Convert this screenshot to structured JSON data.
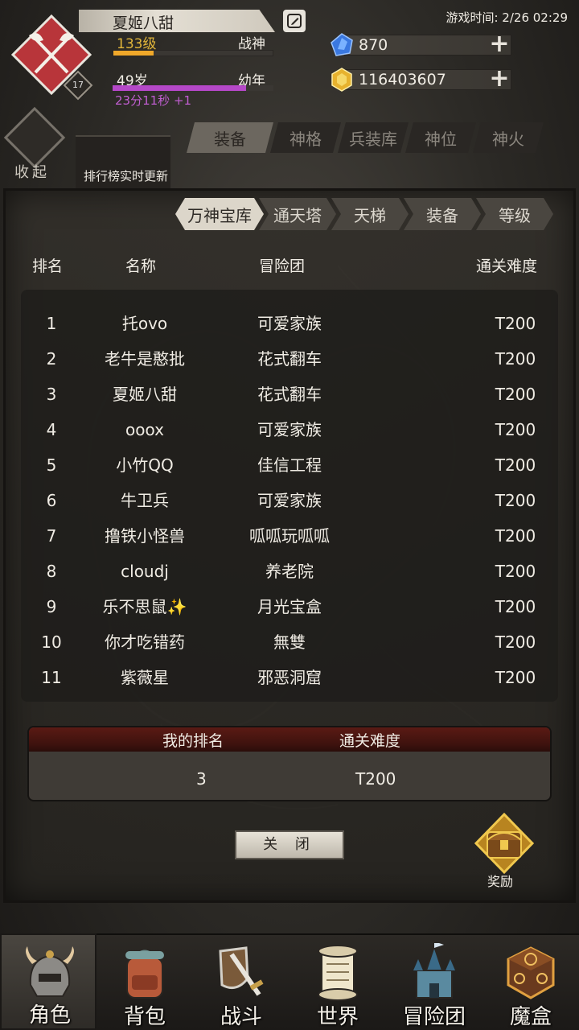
{
  "player": {
    "name": "夏姬八甜",
    "level": "133级",
    "title": "战神",
    "level_progress": 0.25,
    "badge": "17",
    "age": "49岁",
    "stage": "幼年",
    "age_progress": 0.83,
    "timer": "23分11秒 +1"
  },
  "game_time": "游戏时间: 2/26 02:29",
  "currency": {
    "gems": "870",
    "gold": "116403607"
  },
  "collapse_label": "收起",
  "notice": "排行榜实时更新",
  "top_tabs": [
    "装备",
    "神格",
    "兵装库",
    "神位",
    "神火"
  ],
  "sub_tabs": [
    "万神宝库",
    "通天塔",
    "天梯",
    "装备",
    "等级"
  ],
  "columns": {
    "rank": "排名",
    "name": "名称",
    "team": "冒险团",
    "difficulty": "通关难度"
  },
  "rows": [
    {
      "rank": "1",
      "name": "托ovo",
      "team": "可爱家族",
      "difficulty": "T200"
    },
    {
      "rank": "2",
      "name": "老牛是憨批",
      "team": "花式翻车",
      "difficulty": "T200"
    },
    {
      "rank": "3",
      "name": "夏姬八甜",
      "team": "花式翻车",
      "difficulty": "T200"
    },
    {
      "rank": "4",
      "name": "ooox",
      "team": "可爱家族",
      "difficulty": "T200"
    },
    {
      "rank": "5",
      "name": "小竹QQ",
      "team": "佳信工程",
      "difficulty": "T200"
    },
    {
      "rank": "6",
      "name": "牛卫兵",
      "team": "可爱家族",
      "difficulty": "T200"
    },
    {
      "rank": "7",
      "name": "撸铁小怪兽",
      "team": "呱呱玩呱呱",
      "difficulty": "T200"
    },
    {
      "rank": "8",
      "name": "cloudj",
      "team": "养老院",
      "difficulty": "T200"
    },
    {
      "rank": "9",
      "name": "乐不思鼠✨",
      "team": "月光宝盒",
      "difficulty": "T200"
    },
    {
      "rank": "10",
      "name": "你才吃错药",
      "team": "無雙",
      "difficulty": "T200"
    },
    {
      "rank": "11",
      "name": "紫薇星",
      "team": "邪恶洞窟",
      "difficulty": "T200"
    }
  ],
  "my_rank": {
    "rank_label": "我的排名",
    "difficulty_label": "通关难度",
    "rank": "3",
    "difficulty": "T200"
  },
  "close_label": "关 闭",
  "reward_label": "奖励",
  "nav": [
    "角色",
    "背包",
    "战斗",
    "世界",
    "冒险团",
    "魔盒"
  ],
  "colors": {
    "level_gold": "#e2b63a",
    "timer_purple": "#c05ed0",
    "age_bar": "#b548c8",
    "xp_bar": "#f0a82a",
    "emblem_red": "#b8353a"
  }
}
